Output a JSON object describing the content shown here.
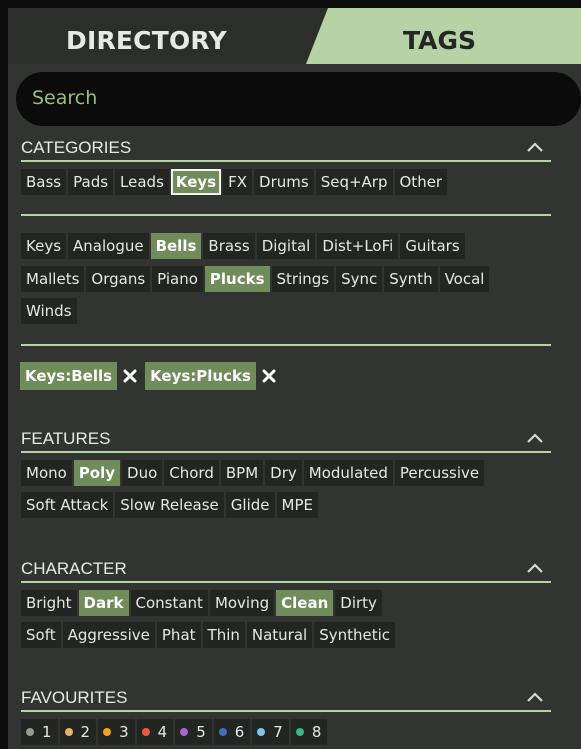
{
  "tabs": {
    "directory": "DIRECTORY",
    "tags": "TAGS"
  },
  "search": {
    "placeholder": "Search"
  },
  "categories": {
    "title": "CATEGORIES",
    "items": [
      "Bass",
      "Pads",
      "Leads",
      "Keys",
      "FX",
      "Drums",
      "Seq+Arp",
      "Other"
    ],
    "selected": "Keys"
  },
  "subcategories": {
    "rows": [
      [
        "Keys",
        "Analogue",
        "Bells",
        "Brass",
        "Digital",
        "Dist+LoFi",
        "Guitars"
      ],
      [
        "Mallets",
        "Organs",
        "Piano",
        "Plucks",
        "Strings",
        "Sync",
        "Synth",
        "Vocal"
      ],
      [
        "Winds"
      ]
    ],
    "selected": [
      "Bells",
      "Plucks"
    ]
  },
  "active_filters": [
    "Keys:Bells",
    "Keys:Plucks"
  ],
  "features": {
    "title": "FEATURES",
    "rows": [
      [
        "Mono",
        "Poly",
        "Duo",
        "Chord",
        "BPM",
        "Dry",
        "Modulated",
        "Percussive"
      ],
      [
        "Soft Attack",
        "Slow Release",
        "Glide",
        "MPE"
      ]
    ],
    "selected": [
      "Poly"
    ]
  },
  "character": {
    "title": "CHARACTER",
    "rows": [
      [
        "Bright",
        "Dark",
        "Constant",
        "Moving",
        "Clean",
        "Dirty"
      ],
      [
        "Soft",
        "Aggressive",
        "Phat",
        "Thin",
        "Natural",
        "Synthetic"
      ]
    ],
    "selected": [
      "Dark",
      "Clean"
    ]
  },
  "favourites": {
    "title": "FAVOURITES",
    "items": [
      {
        "label": "1",
        "color": "#9a9a90"
      },
      {
        "label": "2",
        "color": "#e7b56a"
      },
      {
        "label": "3",
        "color": "#f0a21d"
      },
      {
        "label": "4",
        "color": "#e95b45"
      },
      {
        "label": "5",
        "color": "#a665d6"
      },
      {
        "label": "6",
        "color": "#3d6fc4"
      },
      {
        "label": "7",
        "color": "#7bc5ec"
      },
      {
        "label": "8",
        "color": "#36bb7e"
      }
    ]
  },
  "colors": {
    "accent": "#6f8c5a",
    "divider": "#b5d3a5",
    "panel": "#323432",
    "tag_bg": "#232523"
  }
}
